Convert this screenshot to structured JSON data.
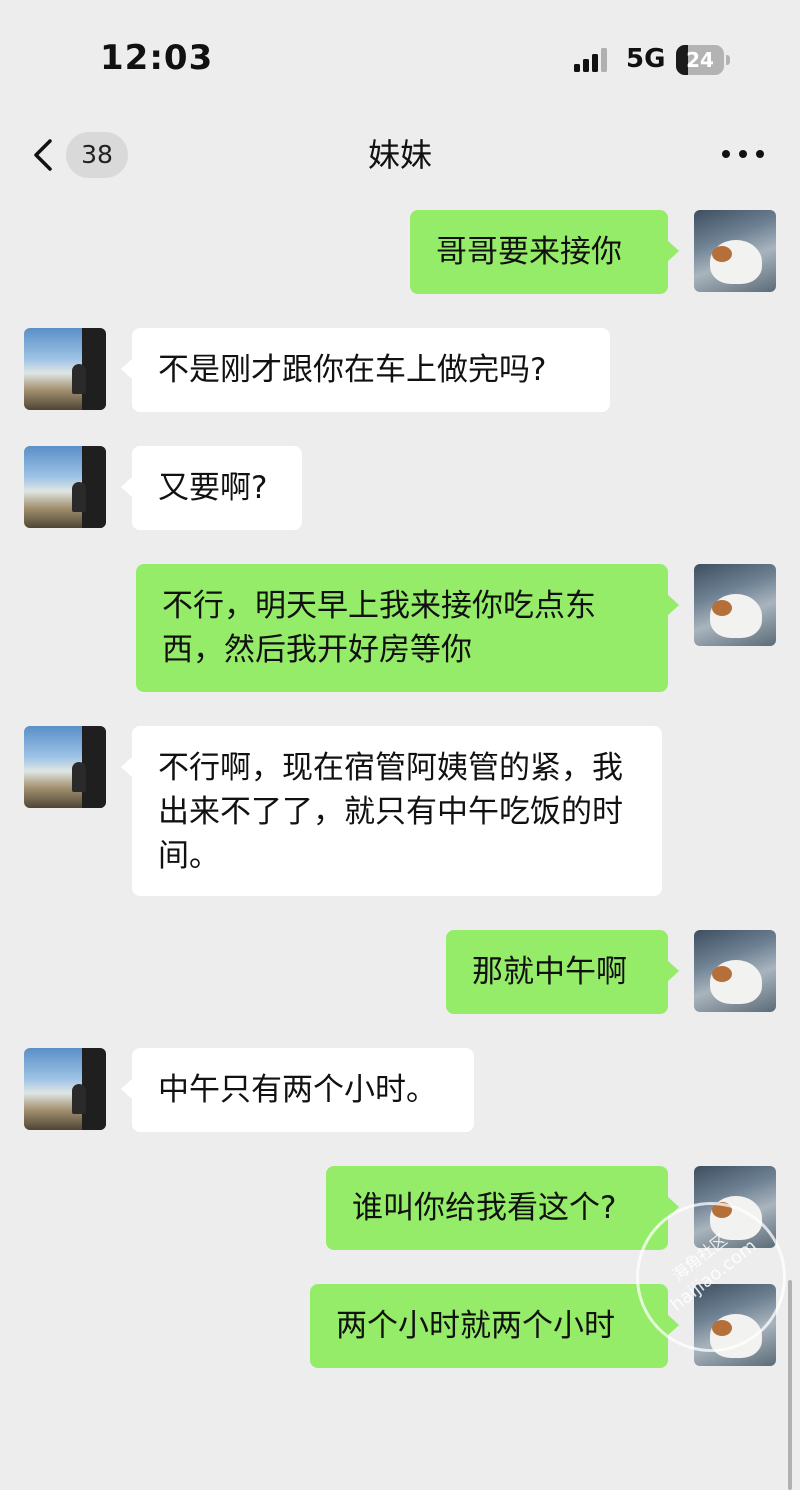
{
  "status_bar": {
    "time": "12:03",
    "network": "5G",
    "battery_level": "24",
    "battery_fraction": 0.24,
    "icons": [
      "signal-icon",
      "battery-icon"
    ]
  },
  "nav": {
    "back_icon": "chevron-left-icon",
    "unread_count": "38",
    "title": "妹妹",
    "more_icon": "more-dots-icon"
  },
  "messages": [
    {
      "side": "right",
      "text": "哥哥要来接你"
    },
    {
      "side": "left",
      "text": "不是刚才跟你在车上做完吗?"
    },
    {
      "side": "left",
      "text": "又要啊?"
    },
    {
      "side": "right",
      "text": "不行，明天早上我来接你吃点东西，然后我开好房等你"
    },
    {
      "side": "left",
      "text": "不行啊，现在宿管阿姨管的紧，我出来不了了，就只有中午吃饭的时间。"
    },
    {
      "side": "right",
      "text": "那就中午啊"
    },
    {
      "side": "left",
      "text": "中午只有两个小时。"
    },
    {
      "side": "right",
      "text": "谁叫你给我看这个?"
    },
    {
      "side": "right",
      "text": "两个小时就两个小时"
    }
  ],
  "watermark": {
    "text": "haijiao.com",
    "sub": "海角社区"
  },
  "colors": {
    "background": "#ededed",
    "bubble_self": "#95ec69",
    "bubble_other": "#ffffff"
  }
}
